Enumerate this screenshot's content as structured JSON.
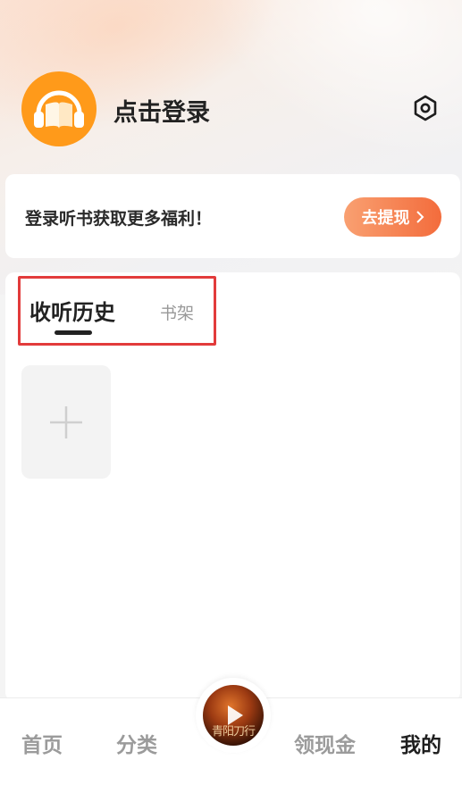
{
  "header": {
    "login_label": "点击登录"
  },
  "promo": {
    "text": "登录听书获取更多福利！",
    "button_label": "去提现"
  },
  "history": {
    "tabs": [
      {
        "label": "收听历史",
        "active": true
      },
      {
        "label": "书架",
        "active": false
      }
    ]
  },
  "player": {
    "cover_text": "青阳刀行"
  },
  "bottom_nav": {
    "items": [
      {
        "label": "首页",
        "active": false
      },
      {
        "label": "分类",
        "active": false
      },
      {
        "label": "领现金",
        "active": false
      },
      {
        "label": "我的",
        "active": true
      }
    ]
  },
  "colors": {
    "accent": "#f36c3c",
    "avatar": "#ff9a1a",
    "highlight_box": "#e23b3b"
  },
  "icons": {
    "avatar": "headphone-book-icon",
    "settings": "hexagon-settings-icon",
    "add": "plus-icon",
    "play": "play-icon",
    "chevron": "chevron-right-icon"
  }
}
